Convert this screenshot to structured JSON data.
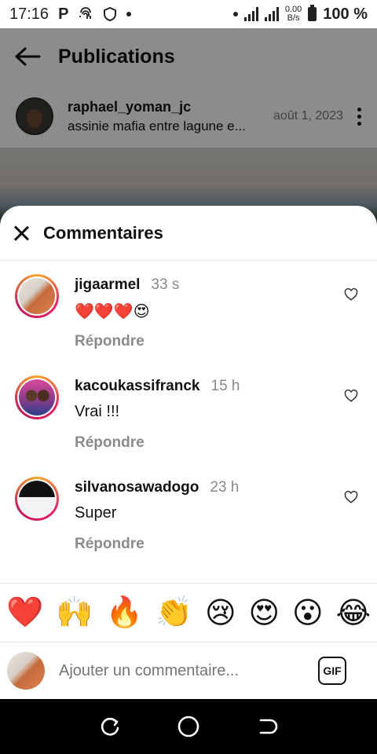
{
  "status_bar": {
    "time": "17:16",
    "network_speed_value": "0.00",
    "network_speed_unit": "B/s",
    "battery": "100 %"
  },
  "header": {
    "title": "Publications"
  },
  "post": {
    "username": "raphael_yoman_jc",
    "caption": "assinie mafia entre lagune e...",
    "date": "août 1, 2023"
  },
  "comments_panel": {
    "title": "Commentaires"
  },
  "comments": [
    {
      "username": "jigaarmel",
      "time": "33 s",
      "text": "❤️❤️❤️😍",
      "reply_label": "Répondre"
    },
    {
      "username": "kacoukassifranck",
      "time": "15 h",
      "text": "Vrai !!!",
      "reply_label": "Répondre"
    },
    {
      "username": "silvanosawadogo",
      "time": "23 h",
      "text": "Super",
      "reply_label": "Répondre"
    }
  ],
  "emoji_bar": [
    "❤️",
    "🙌",
    "🔥",
    "👏",
    "😢",
    "😍",
    "😮",
    "😂"
  ],
  "composer": {
    "placeholder": "Ajouter un commentaire...",
    "gif_label": "GIF"
  }
}
